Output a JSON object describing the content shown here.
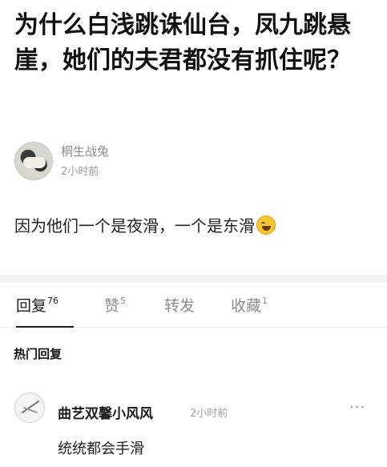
{
  "post": {
    "title": "为什么白浅跳诛仙台，凤九跳悬崖，她们的夫君都没有抓住呢？",
    "author_name": "桐生战兔",
    "time": "2小时前",
    "content": "因为他们一个是夜滑，一个是东滑",
    "emoji": "laughing-crying-emoji"
  },
  "tabs": [
    {
      "label": "回复",
      "count": "76"
    },
    {
      "label": "赞",
      "count": "5"
    },
    {
      "label": "转发",
      "count": ""
    },
    {
      "label": "收藏",
      "count": "1"
    }
  ],
  "section": {
    "hot_replies": "热门回复"
  },
  "comment": {
    "name": "曲艺双馨小风风",
    "time": "2小时前",
    "more": "···",
    "text": "统统都会手滑"
  }
}
